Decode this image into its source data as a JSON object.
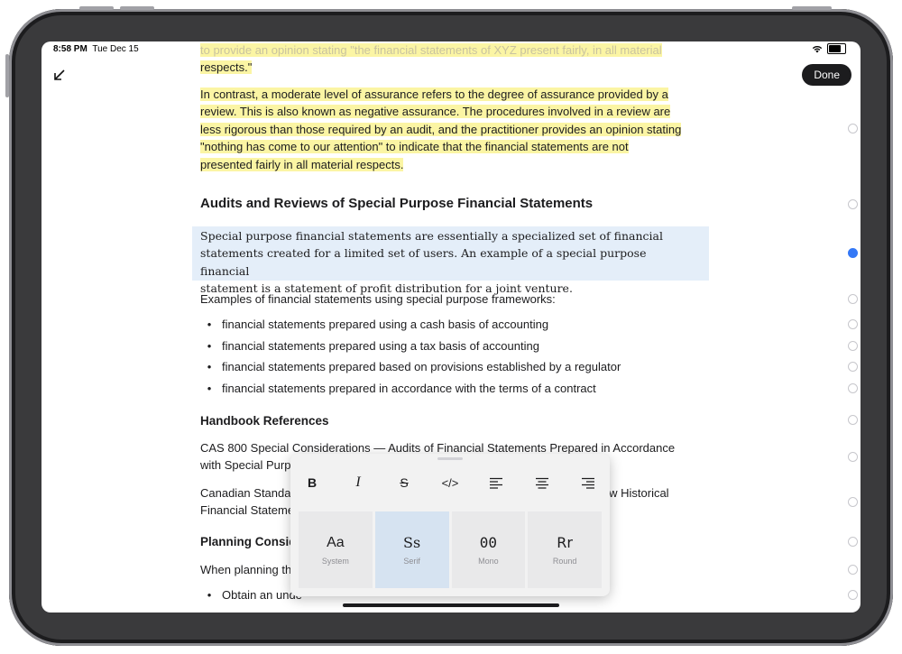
{
  "status_bar": {
    "time": "8:58 PM",
    "date": "Tue Dec 15"
  },
  "toolbar": {
    "done_label": "Done",
    "collapse_icon": "arrow-down-left-icon"
  },
  "document": {
    "top_partial_text": "to provide an opinion stating \"the financial statements of XYZ present fairly, in all material",
    "top_partial_line2": "respects.\"",
    "highlighted_paragraph": [
      "In contrast, a moderate level of assurance refers to the degree of assurance provided by a",
      "review. This is also known as negative assurance. The procedures involved in a review are",
      "less rigorous than those required by an audit, and the practitioner provides an opinion stating",
      "\"nothing has come to our attention\" to indicate that the financial statements are not",
      "presented fairly in all material respects."
    ],
    "heading_1": "Audits and Reviews of Special Purpose Financial Statements",
    "selected_paragraph": [
      "Special purpose financial statements are essentially a specialized set of financial",
      "statements created for a limited set of users. An example of a special purpose financial",
      "statement is a statement of profit distribution for a joint venture."
    ],
    "examples_intro": "Examples of financial statements using special purpose frameworks:",
    "bullets": [
      "financial statements prepared using a cash basis of accounting",
      "financial statements prepared using a tax basis of accounting",
      "financial statements prepared based on provisions established by a regulator",
      "financial statements prepared in accordance with the terms of a contract"
    ],
    "bullet_char": "•",
    "heading_2": "Handbook References",
    "ref_1_line1": "CAS 800 Special Considerations — Audits of Financial Statements Prepared in Accordance",
    "ref_1_line2": "with Special Purpo",
    "ref_2_line1_left": "Canadian Standar",
    "ref_2_line1_right": "iew Historical",
    "ref_2_line2": "Financial Stateme",
    "heading_3": "Planning Consid",
    "planning_text": "When planning th",
    "planning_bullet": "Obtain an unde"
  },
  "format_popover": {
    "buttons": [
      {
        "name": "bold-button",
        "label": "B"
      },
      {
        "name": "italic-button",
        "label": "I"
      },
      {
        "name": "strikethrough-button",
        "label": "S"
      },
      {
        "name": "code-button",
        "label": "</>"
      },
      {
        "name": "align-left-button",
        "label": ""
      },
      {
        "name": "align-center-button",
        "label": ""
      },
      {
        "name": "align-right-button",
        "label": ""
      }
    ],
    "fonts": [
      {
        "sample": "Aa",
        "name": "System"
      },
      {
        "sample": "Ss",
        "name": "Serif"
      },
      {
        "sample": "00",
        "name": "Mono"
      },
      {
        "sample": "Rr",
        "name": "Round"
      }
    ],
    "selected_font": "Serif"
  },
  "colors": {
    "highlight": "#fbf5a4",
    "selection": "#e4eef9",
    "accent": "#3478f6"
  }
}
